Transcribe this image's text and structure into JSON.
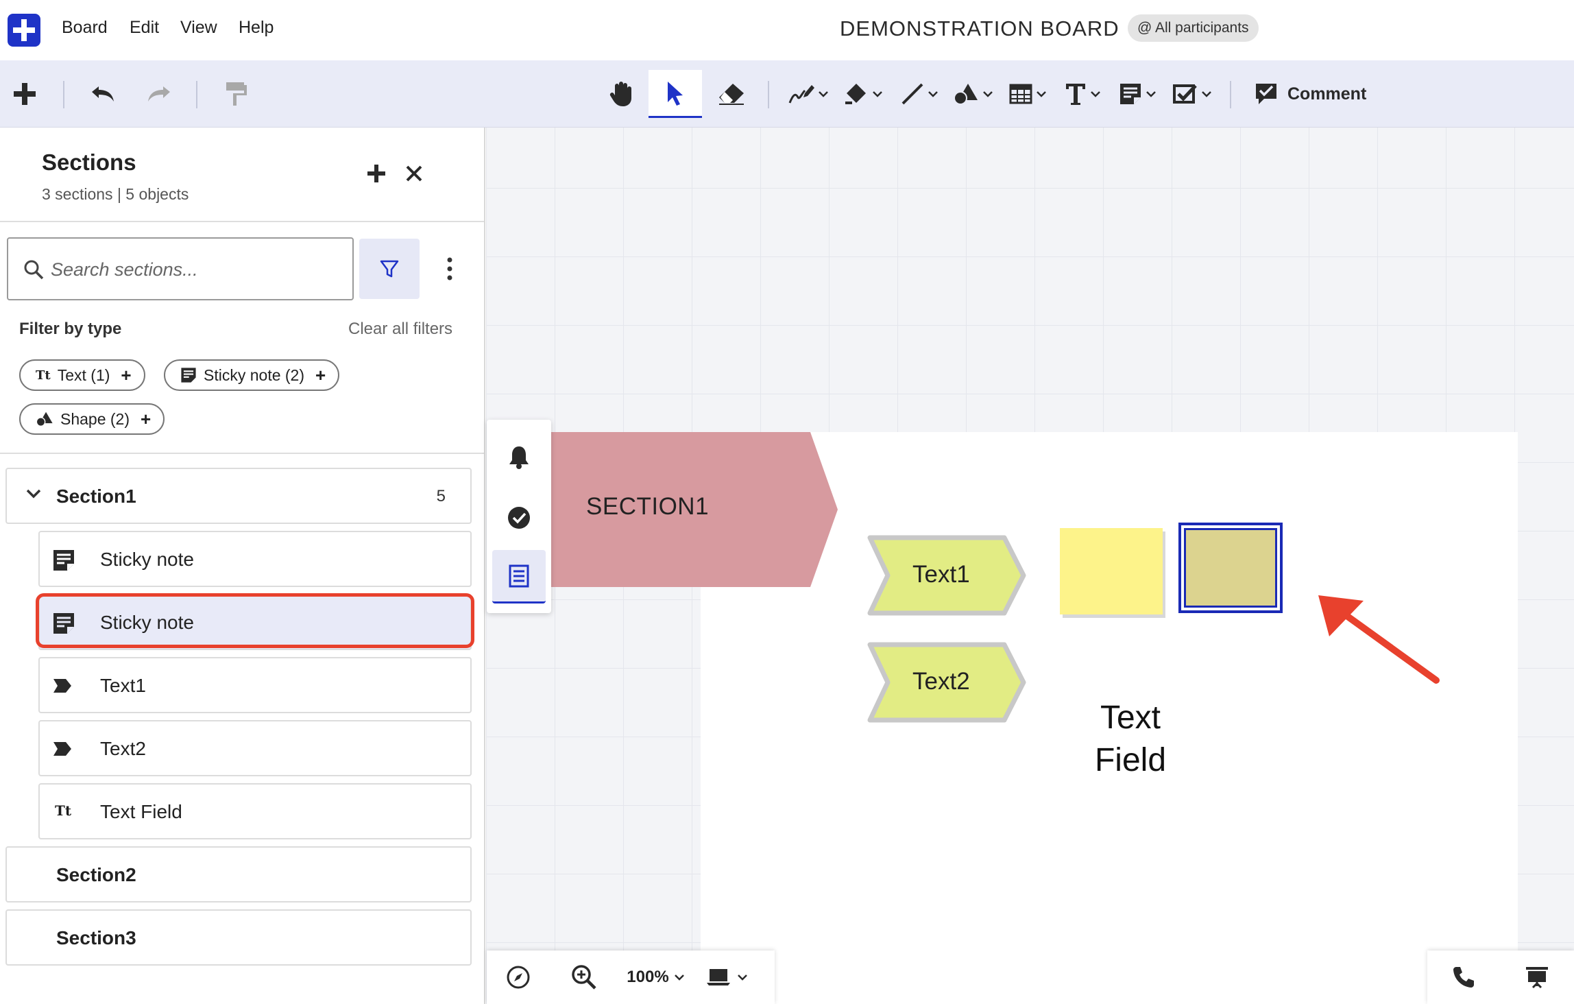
{
  "menu": {
    "items": [
      "Board",
      "Edit",
      "View",
      "Help"
    ],
    "board_title": "DEMONSTRATION BOARD",
    "participants": "@ All participants"
  },
  "toolbar": {
    "comment_label": "Comment",
    "accent": "#1f33c7"
  },
  "sidebar": {
    "title": "Sections",
    "subtitle": "3 sections | 5 objects",
    "search_placeholder": "Search sections...",
    "filter_label": "Filter by type",
    "clear_filters": "Clear all filters",
    "chips": [
      {
        "label": "Text (1)",
        "icon": "text-type-icon"
      },
      {
        "label": "Sticky note (2)",
        "icon": "sticky-note-icon"
      },
      {
        "label": "Shape (2)",
        "icon": "shape-icon"
      }
    ],
    "chip_tt": "Tt",
    "sections": [
      {
        "name": "Section1",
        "count": "5",
        "expanded": true,
        "objects": [
          {
            "label": "Sticky note",
            "icon": "sticky-note-icon"
          },
          {
            "label": "Sticky note",
            "icon": "sticky-note-icon",
            "selected": true
          },
          {
            "label": "Text1",
            "icon": "chevron-shape-icon"
          },
          {
            "label": "Text2",
            "icon": "chevron-shape-icon"
          },
          {
            "label": "Text Field",
            "icon": "text-type-icon"
          }
        ]
      },
      {
        "name": "Section2"
      },
      {
        "name": "Section3"
      }
    ],
    "highlight_color": "#e8412d"
  },
  "canvas": {
    "section_label": "SECTION1",
    "section_color": "#d79a9f",
    "shape1_label": "Text1",
    "shape2_label": "Text2",
    "shape_color": "#e2ec84",
    "text_field_line1": "Text",
    "text_field_line2": "Field",
    "sticky_yellow": "#fdf38a",
    "sticky_olive": "#dcd38f",
    "arrow_color": "#e8412d"
  },
  "bottom": {
    "zoom": "100%"
  }
}
